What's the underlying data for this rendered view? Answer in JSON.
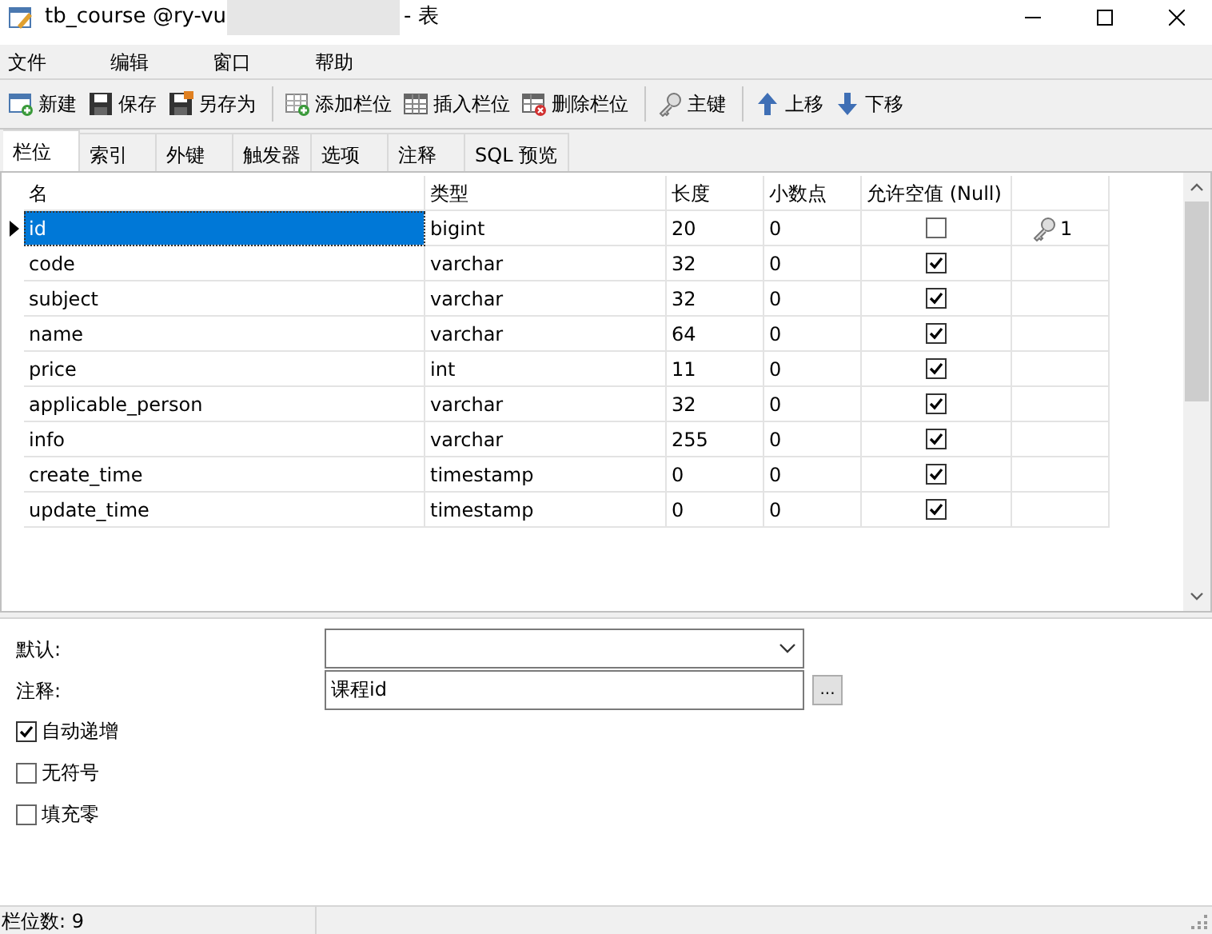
{
  "window": {
    "title_start": "tb_course @ry-vu",
    "title_end": "- 表"
  },
  "menu": [
    "文件",
    "编辑",
    "窗口",
    "帮助"
  ],
  "toolbar": [
    {
      "kind": "new",
      "label": "新建"
    },
    {
      "kind": "save",
      "label": "保存"
    },
    {
      "kind": "saveas",
      "label": "另存为"
    },
    {
      "kind": "sep"
    },
    {
      "kind": "addcol",
      "label": "添加栏位"
    },
    {
      "kind": "inscol",
      "label": "插入栏位"
    },
    {
      "kind": "delcol",
      "label": "删除栏位"
    },
    {
      "kind": "sep"
    },
    {
      "kind": "key",
      "label": "主键"
    },
    {
      "kind": "sep"
    },
    {
      "kind": "up",
      "label": "上移"
    },
    {
      "kind": "down",
      "label": "下移"
    }
  ],
  "tabs": [
    {
      "label": "栏位",
      "selected": true
    },
    {
      "label": "索引",
      "selected": false
    },
    {
      "label": "外键",
      "selected": false
    },
    {
      "label": "触发器",
      "selected": false
    },
    {
      "label": "选项",
      "selected": false
    },
    {
      "label": "注释",
      "selected": false
    },
    {
      "label": "SQL 预览",
      "selected": false
    }
  ],
  "table": {
    "columns": [
      "名",
      "类型",
      "长度",
      "小数点",
      "允许空值 (Null)"
    ],
    "rows": [
      {
        "name": "id",
        "type": "bigint",
        "length": "20",
        "decimals": "0",
        "nullable": false,
        "key": "1",
        "selected": true
      },
      {
        "name": "code",
        "type": "varchar",
        "length": "32",
        "decimals": "0",
        "nullable": true,
        "selected": false
      },
      {
        "name": "subject",
        "type": "varchar",
        "length": "32",
        "decimals": "0",
        "nullable": true,
        "selected": false
      },
      {
        "name": "name",
        "type": "varchar",
        "length": "64",
        "decimals": "0",
        "nullable": true,
        "selected": false
      },
      {
        "name": "price",
        "type": "int",
        "length": "11",
        "decimals": "0",
        "nullable": true,
        "selected": false
      },
      {
        "name": "applicable_person",
        "type": "varchar",
        "length": "32",
        "decimals": "0",
        "nullable": true,
        "selected": false
      },
      {
        "name": "info",
        "type": "varchar",
        "length": "255",
        "decimals": "0",
        "nullable": true,
        "selected": false
      },
      {
        "name": "create_time",
        "type": "timestamp",
        "length": "0",
        "decimals": "0",
        "nullable": true,
        "selected": false
      },
      {
        "name": "update_time",
        "type": "timestamp",
        "length": "0",
        "decimals": "0",
        "nullable": true,
        "selected": false
      }
    ]
  },
  "properties": {
    "default_label": "默认:",
    "comment_label": "注释:",
    "comment_value": "课程id",
    "more_button": "...",
    "options": [
      {
        "label": "自动递增",
        "checked": true
      },
      {
        "label": "无符号",
        "checked": false
      },
      {
        "label": "填充零",
        "checked": false
      }
    ]
  },
  "status_bar": "栏位数: 9"
}
